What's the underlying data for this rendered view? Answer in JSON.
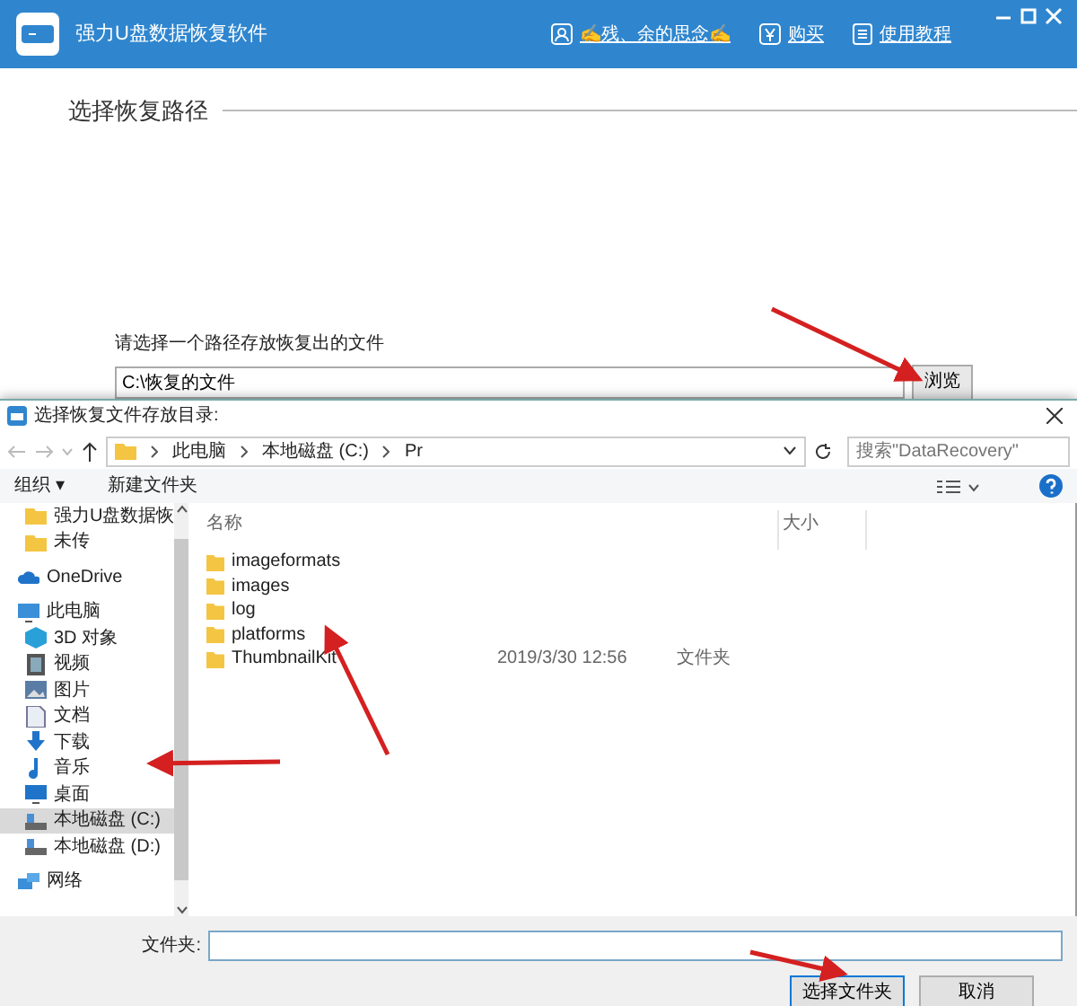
{
  "app": {
    "title": "强力U盘数据恢复软件",
    "user": "✍残、余的思念✍",
    "buy": "购买",
    "help": "使用教程",
    "section_title": "选择恢复路径",
    "path_label": "请选择一个路径存放恢复出的文件",
    "path_value": "C:\\恢复的文件",
    "browse": "浏览"
  },
  "dialog": {
    "title": "选择恢复文件存放目录:",
    "breadcrumb": [
      "此电脑",
      "本地磁盘 (C:)",
      "Pr"
    ],
    "search_placeholder": "搜索\"DataRecovery\"",
    "organize": "组织 ▾",
    "new_folder": "新建文件夹",
    "sidebar": [
      {
        "label": "强力U盘数据恢",
        "kind": "folder",
        "selected": false
      },
      {
        "label": "未传",
        "kind": "folder",
        "selected": false
      },
      {
        "label": "OneDrive",
        "kind": "cloud",
        "selected": false
      },
      {
        "label": "此电脑",
        "kind": "pc",
        "selected": false
      },
      {
        "label": "3D 对象",
        "kind": "cube",
        "selected": false
      },
      {
        "label": "视频",
        "kind": "film",
        "selected": false
      },
      {
        "label": "图片",
        "kind": "image",
        "selected": false
      },
      {
        "label": "文档",
        "kind": "doc",
        "selected": false
      },
      {
        "label": "下载",
        "kind": "download",
        "selected": false
      },
      {
        "label": "音乐",
        "kind": "music",
        "selected": false
      },
      {
        "label": "桌面",
        "kind": "desktop",
        "selected": false
      },
      {
        "label": "本地磁盘 (C:)",
        "kind": "drive",
        "selected": true
      },
      {
        "label": "本地磁盘 (D:)",
        "kind": "drive",
        "selected": false
      },
      {
        "label": "网络",
        "kind": "network",
        "selected": false
      }
    ],
    "columns": [
      "名称",
      "大小"
    ],
    "files": [
      {
        "name": "imageformats"
      },
      {
        "name": "images"
      },
      {
        "name": "log"
      },
      {
        "name": "platforms"
      },
      {
        "name": "ThumbnailKit",
        "date": "2019/3/30 12:56",
        "type": "文件夹"
      }
    ],
    "folder_label": "文件夹:",
    "ok": "选择文件夹",
    "cancel": "取消"
  }
}
